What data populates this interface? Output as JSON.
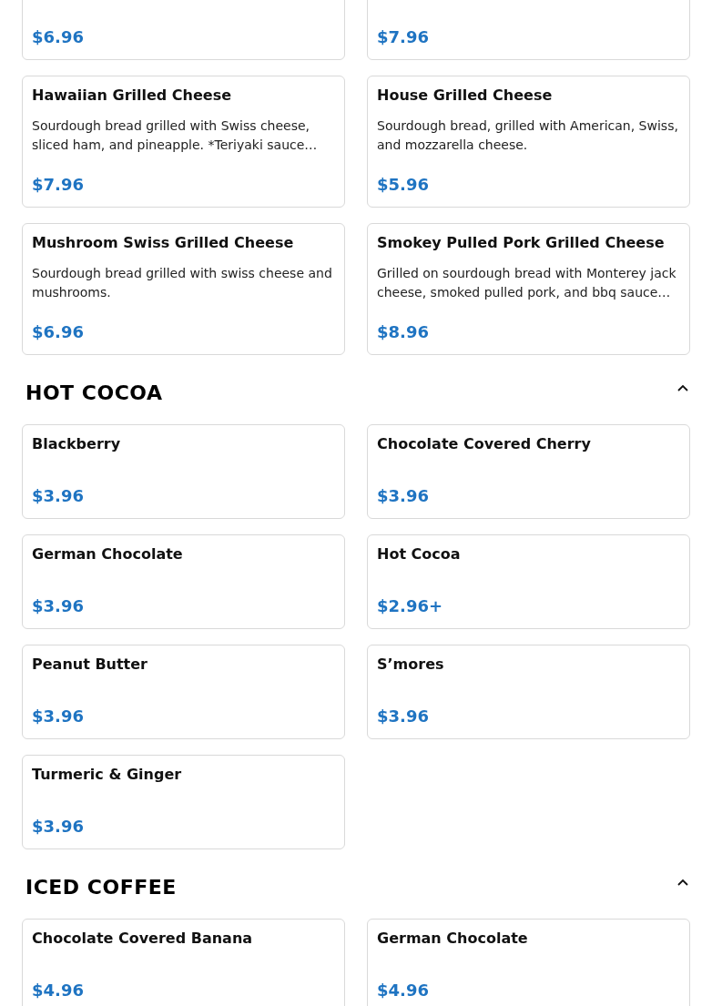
{
  "sections": [
    {
      "items": [
        {
          "price": "$6.96"
        },
        {
          "price": "$7.96"
        },
        {
          "name": "Hawaiian Grilled Cheese",
          "description": "Sourdough bread grilled with Swiss cheese, sliced ham, and pineapple. *Teriyaki sauce…",
          "price": "$7.96"
        },
        {
          "name": "House Grilled Cheese",
          "description": "Sourdough bread, grilled with American, Swiss, and mozzarella cheese.",
          "price": "$5.96"
        },
        {
          "name": "Mushroom Swiss Grilled Cheese",
          "description": "Sourdough bread grilled with swiss cheese and mushrooms.",
          "price": "$6.96"
        },
        {
          "name": "Smokey Pulled Pork Grilled Cheese",
          "description": "Grilled on sourdough bread with Monterey jack cheese, smoked pulled pork, and bbq sauce…",
          "price": "$8.96"
        }
      ]
    },
    {
      "title": "HOT COCOA",
      "expanded": true,
      "items": [
        {
          "name": "Blackberry",
          "price": "$3.96"
        },
        {
          "name": "Chocolate Covered Cherry",
          "price": "$3.96"
        },
        {
          "name": "German Chocolate",
          "price": "$3.96"
        },
        {
          "name": "Hot Cocoa",
          "price": "$2.96+"
        },
        {
          "name": "Peanut Butter",
          "price": "$3.96"
        },
        {
          "name": "S’mores",
          "price": "$3.96"
        },
        {
          "name": "Turmeric & Ginger",
          "price": "$3.96"
        }
      ]
    },
    {
      "title": "ICED COFFEE",
      "expanded": true,
      "items": [
        {
          "name": "Chocolate Covered Banana",
          "price": "$4.96"
        },
        {
          "name": "German Chocolate",
          "price": "$4.96"
        }
      ]
    }
  ]
}
